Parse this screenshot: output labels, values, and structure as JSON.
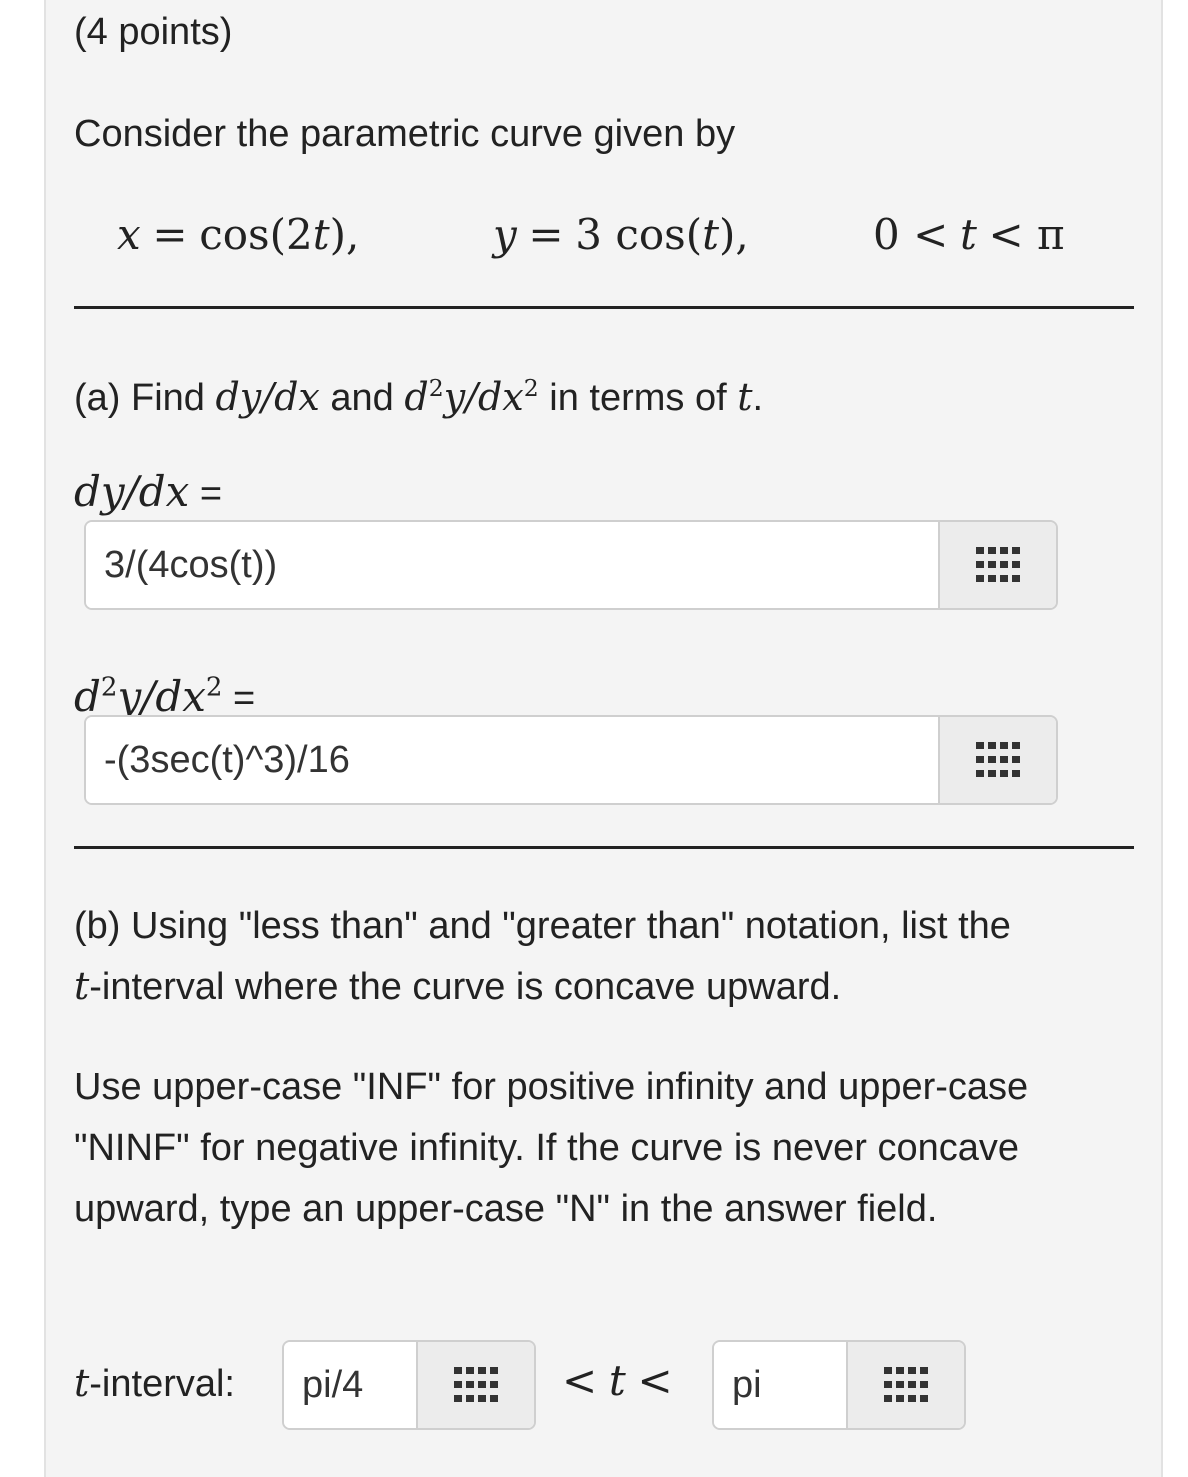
{
  "points": "(4 points)",
  "intro": "Consider the parametric curve given by",
  "equations": {
    "x_lhs": "x",
    "eq": "=",
    "x_rhs": "cos(2",
    "t": "t",
    "close": "),",
    "y_lhs": "y",
    "y_rhs": "3 cos(",
    "domain_left": "0 <",
    "domain_t": "t",
    "domain_right": "< π"
  },
  "part_a": {
    "prefix": "(a) Find",
    "dydx": "dy/dx",
    "and": "and",
    "d2": "d",
    "two": "2",
    "y_over_dx": "y/dx",
    "suffix_in": "in terms of",
    "t": "t",
    "period": ".",
    "label1_main": "dy/dx",
    "label1_eq": "=",
    "answer1": "3/(4cos(t))",
    "label2_d": "d",
    "label2_y": "y/dx",
    "label2_eq": "=",
    "answer2": "-(3sec(t)^3)/16"
  },
  "part_b": {
    "line1": "(b) Using \"less than\" and \"greater than\" notation, list the",
    "line2_t": "t",
    "line2_rest": "-interval where the curve is concave upward.",
    "instructions": "Use upper-case \"INF\" for positive infinity and upper-case \"NINF\" for negative infinity. If the curve is never concave upward, type an upper-case \"N\" in the answer field.",
    "interval_t": "t",
    "interval_label": "-interval:",
    "lower_value": "pi/4",
    "between_lt1": "<",
    "between_t": "t",
    "between_lt2": "<",
    "upper_value": "pi"
  },
  "icons": {
    "math_keyboard": "grid-keypad-icon"
  }
}
